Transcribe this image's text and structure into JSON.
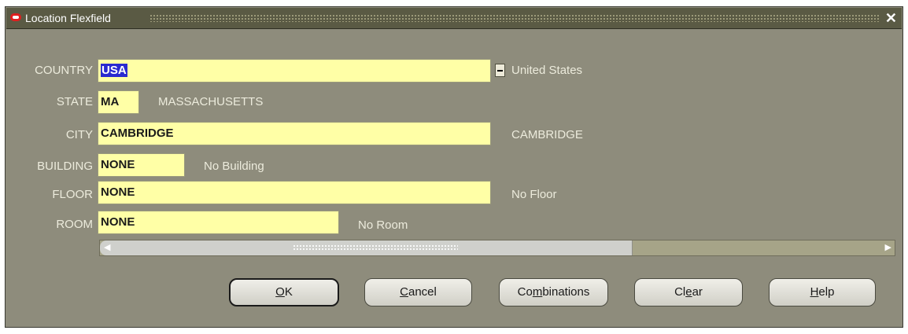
{
  "window": {
    "title": "Location Flexfield",
    "close_glyph": "✕"
  },
  "fields": {
    "country": {
      "label": "COUNTRY",
      "value": "USA",
      "description": "United States"
    },
    "state": {
      "label": "STATE",
      "value": "MA",
      "description": "MASSACHUSETTS"
    },
    "city": {
      "label": "CITY",
      "value": "CAMBRIDGE",
      "description": "CAMBRIDGE"
    },
    "building": {
      "label": "BUILDING",
      "value": "NONE",
      "description": "No Building"
    },
    "floor": {
      "label": "FLOOR",
      "value": "NONE",
      "description": "No Floor"
    },
    "room": {
      "label": "ROOM",
      "value": "NONE",
      "description": "No Room"
    }
  },
  "scrollbar": {
    "left_arrow": "◀",
    "right_arrow": "▶"
  },
  "buttons": {
    "ok": {
      "pre": "",
      "mnemonic": "O",
      "post": "K"
    },
    "cancel": {
      "pre": "",
      "mnemonic": "C",
      "post": "ancel"
    },
    "combinations": {
      "pre": "Co",
      "mnemonic": "m",
      "post": "binations"
    },
    "clear": {
      "pre": "Cl",
      "mnemonic": "e",
      "post": "ar"
    },
    "help": {
      "pre": "",
      "mnemonic": "H",
      "post": "elp"
    }
  },
  "colors": {
    "window_bg": "#8e8c7c",
    "titlebar_bg": "#5a5a44",
    "field_bg": "#ffffa6",
    "selection_bg": "#2a2ad0",
    "label_text": "#ecebdc",
    "oracle_red": "#e01e1e"
  },
  "icons": {
    "title": "oracle-logo-icon",
    "close": "close-icon",
    "list_of_values": "ellipsis-icon"
  }
}
